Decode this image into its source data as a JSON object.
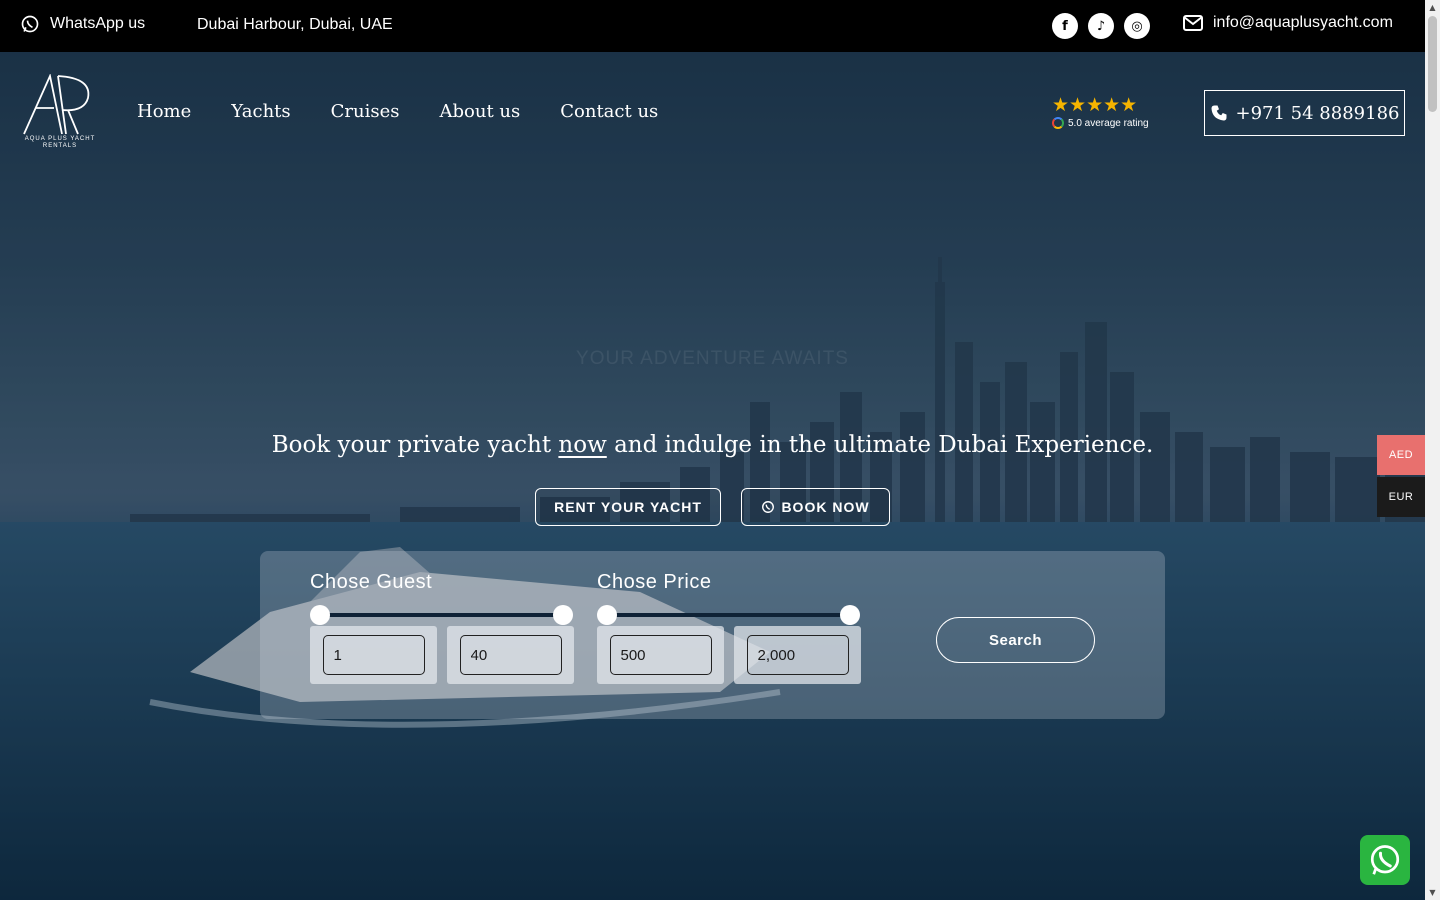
{
  "topbar": {
    "whatsapp_label": "WhatsApp us",
    "location": "Dubai Harbour, Dubai, UAE",
    "socials": [
      {
        "icon": "facebook-icon",
        "glyph": "f"
      },
      {
        "icon": "tiktok-icon",
        "glyph": "♪"
      },
      {
        "icon": "instagram-icon",
        "glyph": "◎"
      }
    ],
    "email": "info@aquaplusyacht.com"
  },
  "header": {
    "logo_text": "AQUA PLUS YACHT RENTALS",
    "nav": [
      "Home",
      "Yachts",
      "Cruises",
      "About us",
      "Contact us"
    ],
    "rating": {
      "stars": "★★★★★",
      "text": "5.0 average rating",
      "value": 5.0
    },
    "phone": "+971 54 8889186"
  },
  "hero": {
    "tagline": "YOUR ADVENTURE AWAITS",
    "headline_before": "Book your private yacht ",
    "headline_link": "now",
    "headline_after": " and indulge in the ultimate Dubai Experience.",
    "cta_rent": "RENT YOUR YACHT",
    "cta_book": "BOOK NOW"
  },
  "search": {
    "guest_label": "Chose Guest",
    "guest_min": "1",
    "guest_max": "40",
    "price_label": "Chose Price",
    "price_min": "500",
    "price_max": "2,000",
    "button": "Search"
  },
  "currency": {
    "active": "AED",
    "other": "EUR"
  },
  "colors": {
    "topbar": "#000000",
    "accent_currency": "#e8706e",
    "whatsapp": "#2ab540",
    "stars": "#f5b400"
  }
}
